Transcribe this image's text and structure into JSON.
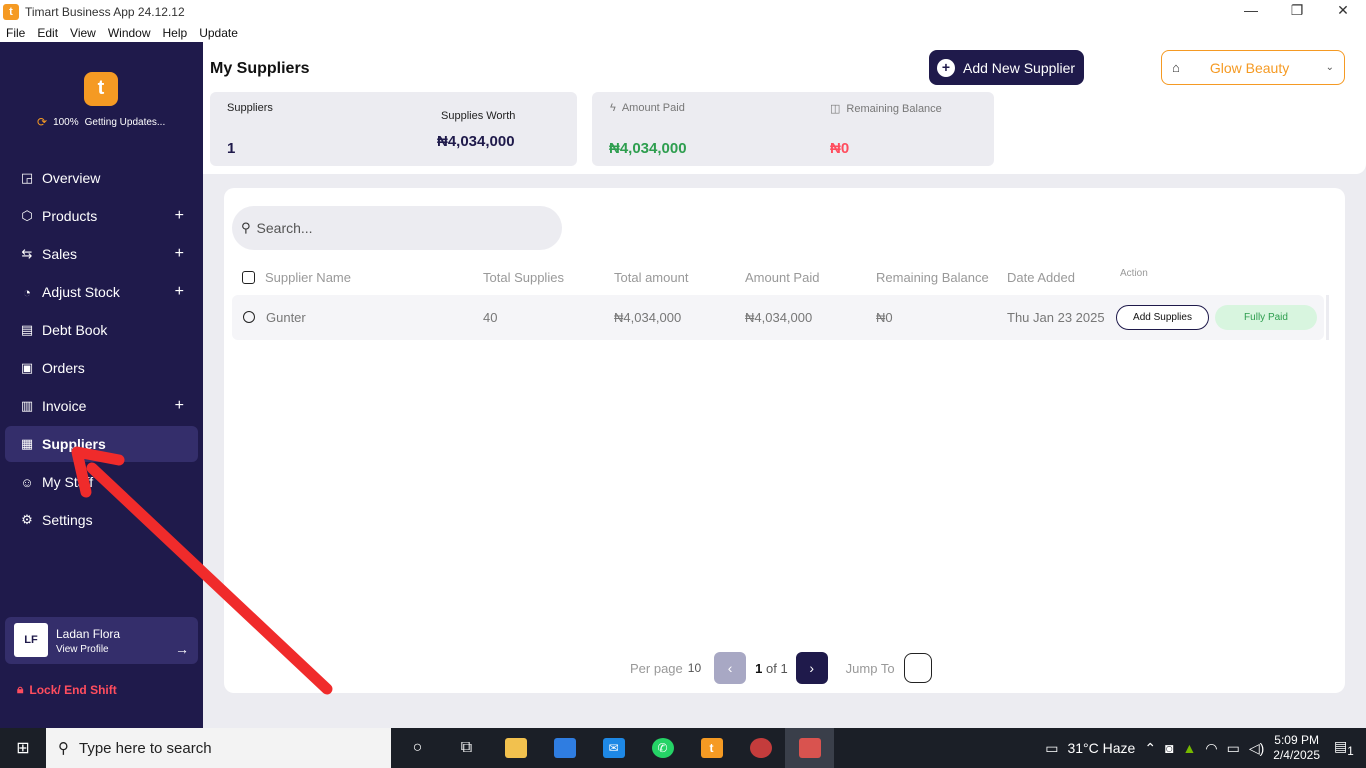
{
  "window": {
    "title": "Timart Business App 24.12.12",
    "app_icon": "t",
    "controls": {
      "minimize": "—",
      "restore": "❐",
      "close": "✕"
    }
  },
  "menu": [
    "File",
    "Edit",
    "View",
    "Window",
    "Help",
    "Update"
  ],
  "sidebar": {
    "logo": "t",
    "update_percent": "100%",
    "update_status": "Getting Updates...",
    "items": [
      {
        "label": "Overview",
        "icon": "overview-icon",
        "glyph": "◲",
        "has_plus": false,
        "active": false
      },
      {
        "label": "Products",
        "icon": "box-icon",
        "glyph": "⬡",
        "has_plus": true,
        "active": false
      },
      {
        "label": "Sales",
        "icon": "sales-icon",
        "glyph": "⇆",
        "has_plus": true,
        "active": false
      },
      {
        "label": "Adjust Stock",
        "icon": "adjust-stock-icon",
        "glyph": "◔",
        "has_plus": true,
        "active": false
      },
      {
        "label": "Debt Book",
        "icon": "book-icon",
        "glyph": "▤",
        "has_plus": false,
        "active": false
      },
      {
        "label": "Orders",
        "icon": "clipboard-icon",
        "glyph": "▣",
        "has_plus": false,
        "active": false
      },
      {
        "label": "Invoice",
        "icon": "invoice-icon",
        "glyph": "▥",
        "has_plus": true,
        "active": false
      },
      {
        "label": "Suppliers",
        "icon": "id-card-icon",
        "glyph": "▦",
        "has_plus": false,
        "active": true
      },
      {
        "label": "My Staff",
        "icon": "people-icon",
        "glyph": "☺",
        "has_plus": false,
        "active": false
      },
      {
        "label": "Settings",
        "icon": "gear-icon",
        "glyph": "⚙",
        "has_plus": false,
        "active": false
      }
    ],
    "plus": "+",
    "profile": {
      "initials": "LF",
      "name": "Ladan Flora",
      "link": "View Profile",
      "arrow": "→"
    },
    "lock_label": "Lock/ End Shift"
  },
  "header": {
    "title": "My Suppliers",
    "add_button": "Add New Supplier",
    "store": "Glow Beauty"
  },
  "stats": {
    "suppliers_label": "Suppliers",
    "suppliers_value": "1",
    "worth_label": "Supplies Worth",
    "worth_value": "₦4,034,000",
    "paid_label": "Amount Paid",
    "paid_value": "₦4,034,000",
    "remaining_label": "Remaining Balance",
    "remaining_value": "₦0"
  },
  "table": {
    "search_placeholder": "Search...",
    "headers": {
      "name": "Supplier Name",
      "total_supplies": "Total Supplies",
      "total_amount": "Total amount",
      "amount_paid": "Amount Paid",
      "remaining": "Remaining Balance",
      "date": "Date Added",
      "action": "Action"
    },
    "rows": [
      {
        "name": "Gunter",
        "total_supplies": "40",
        "total_amount": "₦4,034,000",
        "amount_paid": "₦4,034,000",
        "remaining": "₦0",
        "date": "Thu Jan 23 2025",
        "action_label": "Add Supplies",
        "status": "Fully Paid"
      }
    ]
  },
  "pagination": {
    "per_page_label": "Per page",
    "per_page_value": "10",
    "current": "1",
    "of_text": "of 1",
    "jump_label": "Jump To"
  },
  "taskbar": {
    "search_text": "Type here to search",
    "weather": "31°C  Haze",
    "time": "5:09 PM",
    "date": "2/4/2025",
    "notification_count": "1"
  },
  "colors": {
    "sidebar_bg": "#1f1a4b",
    "accent_orange": "#f59a23",
    "green": "#2e9e4f",
    "red": "#ff4d5e",
    "annotation_red": "#f02b2b"
  }
}
